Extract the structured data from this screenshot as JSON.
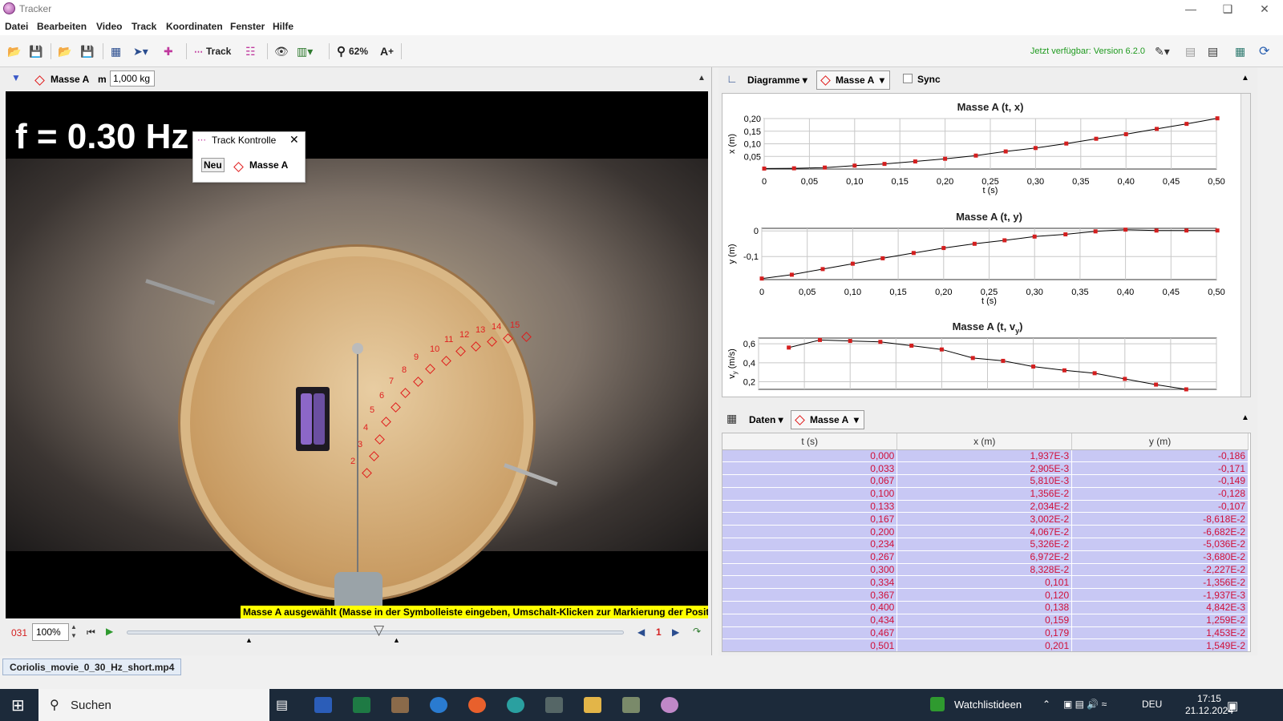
{
  "window": {
    "title": "Tracker"
  },
  "menu": [
    "Datei",
    "Bearbeiten",
    "Video",
    "Track",
    "Koordinaten",
    "Fenster",
    "Hilfe"
  ],
  "toolbar": {
    "track_label": "Track",
    "zoom_label": "62%",
    "update_text": "Jetzt verfügbar: Version 6.2.0"
  },
  "trackbar": {
    "track_name": "Masse A",
    "mass_label": "m",
    "mass_value": "1,000 kg"
  },
  "track_control": {
    "title": "Track Kontrolle",
    "new_button": "Neu",
    "track_name": "Masse A"
  },
  "video": {
    "overlay_text": "f = 0.30 Hz",
    "status_text": "Masse A ausgewählt (Masse in der Symbolleiste eingeben, Umschalt-Klicken zur Markierung der Position)",
    "point_labels": [
      "2",
      "3",
      "4",
      "5",
      "6",
      "7",
      "8",
      "9",
      "10",
      "11",
      "12",
      "13",
      "14",
      "15"
    ]
  },
  "player": {
    "frame": "031",
    "zoom": "100%",
    "step": "1"
  },
  "plot_panel": {
    "view_label": "Diagramme",
    "track_name": "Masse A",
    "sync_label": "Sync"
  },
  "table_panel": {
    "view_label": "Daten",
    "track_name": "Masse A"
  },
  "chart_data": [
    {
      "type": "line",
      "title": "Masse A (t, x)",
      "xlabel": "t (s)",
      "ylabel": "x (m)",
      "x_ticks": [
        "0",
        "0,05",
        "0,10",
        "0,15",
        "0,20",
        "0,25",
        "0,30",
        "0,35",
        "0,40",
        "0,45",
        "0,50"
      ],
      "y_ticks": [
        "0,05",
        "0,10",
        "0,15",
        "0,20"
      ],
      "xlim": [
        0,
        0.5
      ],
      "ylim": [
        0,
        0.2
      ],
      "x": [
        0.0,
        0.033,
        0.067,
        0.1,
        0.133,
        0.167,
        0.2,
        0.234,
        0.267,
        0.3,
        0.334,
        0.367,
        0.4,
        0.434,
        0.467,
        0.501
      ],
      "y": [
        0.001937,
        0.002905,
        0.00581,
        0.01356,
        0.02034,
        0.03002,
        0.04067,
        0.05326,
        0.06972,
        0.08328,
        0.101,
        0.12,
        0.138,
        0.159,
        0.179,
        0.201
      ]
    },
    {
      "type": "line",
      "title": "Masse A (t, y)",
      "xlabel": "t (s)",
      "ylabel": "y (m)",
      "x_ticks": [
        "0",
        "0,05",
        "0,10",
        "0,15",
        "0,20",
        "0,25",
        "0,30",
        "0,35",
        "0,40",
        "0,45",
        "0,50"
      ],
      "y_ticks": [
        "-0,1",
        "0"
      ],
      "xlim": [
        0,
        0.5
      ],
      "ylim": [
        -0.19,
        0.01
      ],
      "x": [
        0.0,
        0.033,
        0.067,
        0.1,
        0.133,
        0.167,
        0.2,
        0.234,
        0.267,
        0.3,
        0.334,
        0.367,
        0.4,
        0.434,
        0.467,
        0.501
      ],
      "y": [
        -0.186,
        -0.171,
        -0.149,
        -0.128,
        -0.107,
        -0.08618,
        -0.06682,
        -0.05036,
        -0.0368,
        -0.02227,
        -0.01356,
        -0.001937,
        0.004842,
        0.001259,
        0.001453,
        0.001549
      ]
    },
    {
      "type": "line",
      "title": "Masse A (t, v",
      "title_sub": "y",
      "title_end": ")",
      "ylabel": "v",
      "ylabel_sub": "y",
      "ylabel_end": " (m/s)",
      "y_ticks": [
        "0,2",
        "0,4",
        "0,6"
      ],
      "xlim": [
        0,
        0.5
      ],
      "ylim": [
        0.12,
        0.66
      ],
      "x": [
        0.033,
        0.067,
        0.1,
        0.133,
        0.167,
        0.2,
        0.234,
        0.267,
        0.3,
        0.334,
        0.367,
        0.4,
        0.434,
        0.467
      ],
      "y": [
        0.56,
        0.64,
        0.63,
        0.62,
        0.58,
        0.54,
        0.45,
        0.42,
        0.36,
        0.32,
        0.29,
        0.23,
        0.17,
        0.12
      ]
    }
  ],
  "table": {
    "headers": [
      "t (s)",
      "x (m)",
      "y (m)"
    ],
    "rows": [
      [
        "0,000",
        "1,937E-3",
        "-0,186"
      ],
      [
        "0,033",
        "2,905E-3",
        "-0,171"
      ],
      [
        "0,067",
        "5,810E-3",
        "-0,149"
      ],
      [
        "0,100",
        "1,356E-2",
        "-0,128"
      ],
      [
        "0,133",
        "2,034E-2",
        "-0,107"
      ],
      [
        "0,167",
        "3,002E-2",
        "-8,618E-2"
      ],
      [
        "0,200",
        "4,067E-2",
        "-6,682E-2"
      ],
      [
        "0,234",
        "5,326E-2",
        "-5,036E-2"
      ],
      [
        "0,267",
        "6,972E-2",
        "-3,680E-2"
      ],
      [
        "0,300",
        "8,328E-2",
        "-2,227E-2"
      ],
      [
        "0,334",
        "0,101",
        "-1,356E-2"
      ],
      [
        "0,367",
        "0,120",
        "-1,937E-3"
      ],
      [
        "0,400",
        "0,138",
        "4,842E-3"
      ],
      [
        "0,434",
        "0,159",
        "1,259E-2"
      ],
      [
        "0,467",
        "0,179",
        "1,453E-2"
      ],
      [
        "0,501",
        "0,201",
        "1,549E-2"
      ]
    ]
  },
  "file_tab": "Coriolis_movie_0_30_Hz_short.mp4",
  "taskbar": {
    "search_label": "Suchen",
    "widget_label": "Watchlistideen",
    "lang": "DEU",
    "time": "17:15",
    "date": "21.12.2024"
  },
  "colors": {
    "track_red": "#e02020",
    "table_bg": "#c8c8f4",
    "update_green": "#1f9a1f",
    "status_yellow": "#ffff00"
  }
}
